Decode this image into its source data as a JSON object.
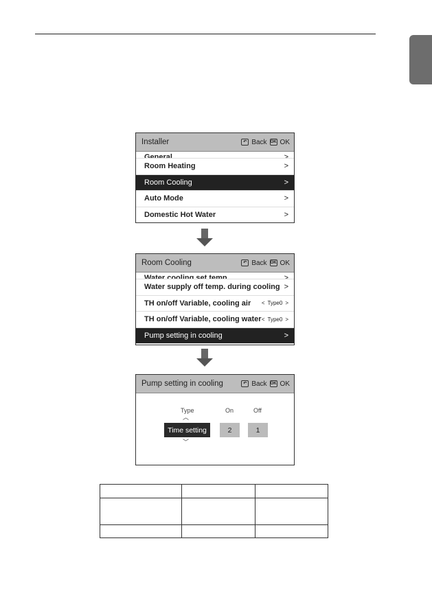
{
  "page": {
    "chapter_tab_color": "#6d6d6d"
  },
  "screen1": {
    "title": "Installer",
    "back_label": "Back",
    "ok_label": "OK",
    "back_icon": "back-arrow-icon",
    "ok_icon": "ok-icon",
    "ok_icon_text": "OK",
    "items": [
      {
        "label": "General",
        "chevron": ">"
      },
      {
        "label": "Room Heating",
        "chevron": ">"
      },
      {
        "label": "Room Cooling",
        "chevron": ">",
        "selected": true
      },
      {
        "label": "Auto Mode",
        "chevron": ">"
      },
      {
        "label": "Domestic Hot Water",
        "chevron": ">"
      }
    ]
  },
  "screen2": {
    "title": "Room Cooling",
    "back_label": "Back",
    "ok_label": "OK",
    "ok_icon_text": "OK",
    "items": [
      {
        "label": "Water cooling set temp.",
        "chevron": ">"
      },
      {
        "label": "Water supply off temp. during cooling",
        "chevron": ">"
      },
      {
        "label": "TH on/off Variable, cooling air",
        "value": "Type0",
        "left": "<",
        "right": ">"
      },
      {
        "label": "TH on/off Variable, cooling water",
        "value": "Type0",
        "left": "<",
        "right": ">"
      },
      {
        "label": "Pump setting in cooling",
        "chevron": ">",
        "selected": true
      }
    ]
  },
  "screen3": {
    "title": "Pump setting in cooling",
    "back_label": "Back",
    "ok_label": "OK",
    "ok_icon_text": "OK",
    "type_label": "Type",
    "on_label": "On",
    "off_label": "Off",
    "type_value": "Time setting",
    "on_value": "2",
    "off_value": "1",
    "up_glyph": "︿",
    "down_glyph": "﹀"
  },
  "table": {
    "rows": [
      [
        "",
        "",
        ""
      ],
      [
        "",
        "",
        ""
      ],
      [
        "",
        "",
        ""
      ]
    ]
  }
}
